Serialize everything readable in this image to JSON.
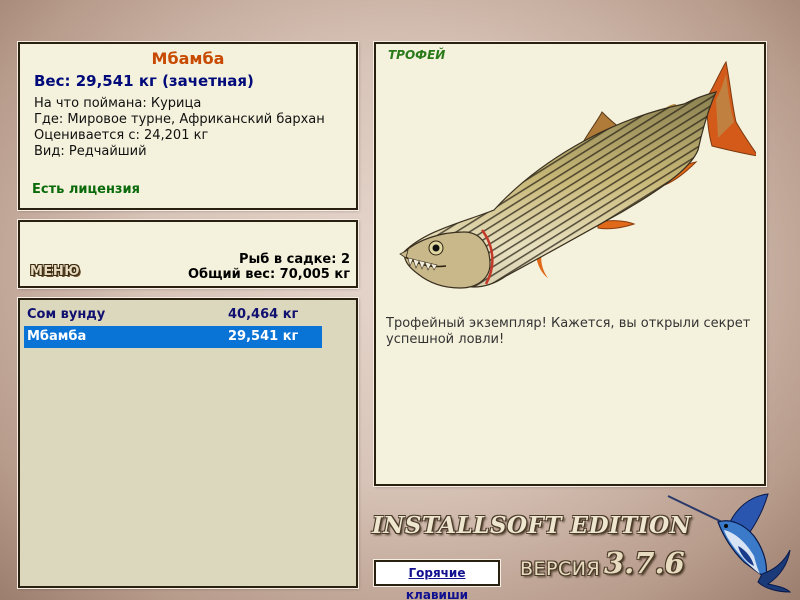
{
  "fish": {
    "name": "Мбамба",
    "weight_line": "Вес: 29,541 кг (зачетная)",
    "bait_line": "На что поймана: Курица",
    "location_line": "Где: Мировое турне, Африканский бархан",
    "valued_line": "Оценивается с: 24,201 кг",
    "rarity_line": "Вид: Редчайший",
    "license": "Есть лицензия"
  },
  "keepnet": {
    "menu_label": "МЕНЮ",
    "count_line": "Рыб в садке: 2",
    "total_line": "Общий вес: 70,005 кг"
  },
  "catch_list": [
    {
      "name": "Сом вунду",
      "weight": "40,464 кг",
      "selected": false
    },
    {
      "name": "Мбамба",
      "weight": "29,541 кг",
      "selected": true
    }
  ],
  "trophy": {
    "label": "ТРОФЕЙ",
    "image_icon": "tigerfish-image",
    "message": "Трофейный экземпляр! Кажется, вы открыли секрет успешной ловли!"
  },
  "branding": {
    "edition": "INSTALLSOFT EDITION",
    "version_word": "ВЕРСИЯ",
    "version_number": "3.7.6",
    "logo_icon": "marlin-logo"
  },
  "hotkeys_label": "Горячие клавиши",
  "colors": {
    "fish_name": "#c84a00",
    "weight": "#000a7a",
    "license": "#0a6a0a",
    "trophy_label": "#2a7a1a",
    "selection": "#0a74d6",
    "panel_bg": "#f4f2dc",
    "list_bg": "#dcd8bd"
  }
}
